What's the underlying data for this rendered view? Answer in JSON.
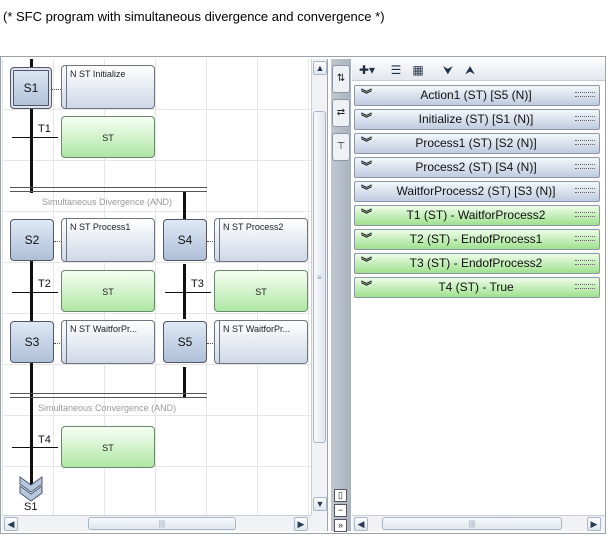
{
  "caption": "(* SFC program with simultaneous divergence and convergence *)",
  "steps": {
    "s1": "S1",
    "s2": "S2",
    "s3": "S3",
    "s4": "S4",
    "s5": "S5",
    "s1_jump": "S1"
  },
  "actions": {
    "a1": "N    ST    Initialize",
    "a2": "N    ST    Process1",
    "a3": "N    ST    Process2",
    "a4": "N    ST    WaitforPr...",
    "a5": "N    ST    WaitforPr..."
  },
  "transitions": {
    "t1": "T1",
    "t2": "T2",
    "t3": "T3",
    "t4": "T4",
    "st": "ST"
  },
  "sections": {
    "divergence": "Simultaneous Divergence (AND)",
    "convergence": "Simultaneous Convergence (AND)"
  },
  "list": [
    {
      "label": "Action1 (ST) [S5 (N)]",
      "kind": "action"
    },
    {
      "label": "Initialize (ST) [S1 (N)]",
      "kind": "action"
    },
    {
      "label": "Process1 (ST) [S2 (N)]",
      "kind": "action"
    },
    {
      "label": "Process2 (ST) [S4 (N)]",
      "kind": "action"
    },
    {
      "label": "WaitforProcess2 (ST) [S3 (N)]",
      "kind": "action"
    },
    {
      "label": "T1 (ST) - WaitforProcess2",
      "kind": "transition"
    },
    {
      "label": "T2 (ST) - EndofProcess1",
      "kind": "transition"
    },
    {
      "label": "T3 (ST) - EndofProcess2",
      "kind": "transition"
    },
    {
      "label": "T4 (ST) - True",
      "kind": "transition"
    }
  ],
  "colors": {
    "action_row": "#bfcbe0",
    "transition_row": "#9fe08f",
    "step": "#aebfd8"
  },
  "icons": [
    "add-icon",
    "list-view-icon",
    "grid-view-icon",
    "collapse-all-icon",
    "expand-all-icon",
    "chevron-down-icon"
  ]
}
